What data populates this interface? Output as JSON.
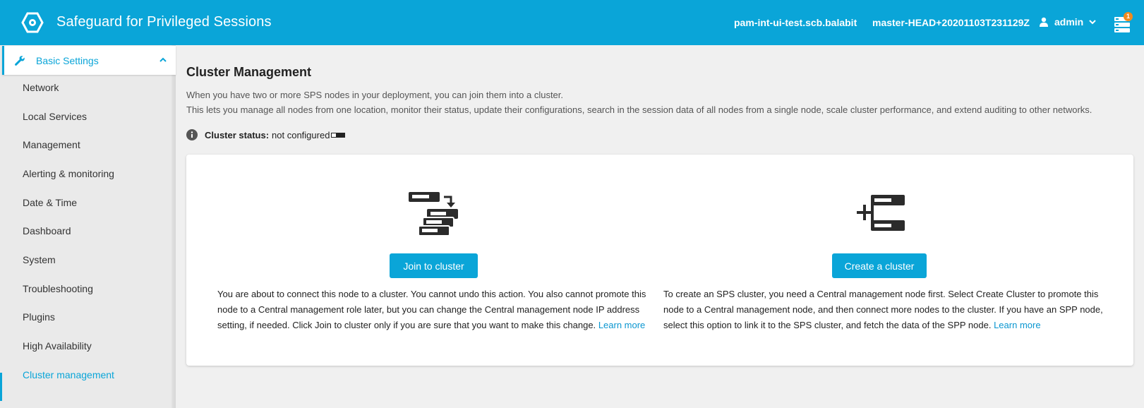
{
  "header": {
    "app_title": "Safeguard for Privileged Sessions",
    "hostname": "pam-int-ui-test.scb.balabit",
    "version": "master-HEAD+20201103T231129Z",
    "user": "admin",
    "notification_count": "1",
    "logo_icon": "safeguard-logo-icon",
    "user_icon": "person-icon",
    "notifications_icon": "server-stack-icon"
  },
  "sidebar": {
    "group": {
      "label": "Basic Settings",
      "icon": "wrench-icon",
      "expanded": true
    },
    "items": [
      {
        "label": "Network"
      },
      {
        "label": "Local Services"
      },
      {
        "label": "Management"
      },
      {
        "label": "Alerting & monitoring"
      },
      {
        "label": "Date & Time"
      },
      {
        "label": "Dashboard"
      },
      {
        "label": "System"
      },
      {
        "label": "Troubleshooting"
      },
      {
        "label": "Plugins"
      },
      {
        "label": "High Availability"
      },
      {
        "label": "Cluster management",
        "active": true
      }
    ]
  },
  "main": {
    "title": "Cluster Management",
    "description_line1": "When you have two or more SPS nodes in your deployment, you can join them into a cluster.",
    "description_line2": "This lets you manage all nodes from one location, monitor their status, update their configurations, search in the session data of all nodes from a single node, scale cluster performance, and extend auditing to other networks.",
    "status_label": "Cluster status:",
    "status_value": "not configured",
    "join": {
      "button": "Join to cluster",
      "text": "You are about to connect this node to a cluster. You cannot undo this action. You also cannot promote this node to a Central management role later, but you can change the Central management node IP address setting, if needed. Click Join to cluster only if you are sure that you want to make this change.",
      "link": "Learn more"
    },
    "create": {
      "button": "Create a cluster",
      "text": "To create an SPS cluster, you need a Central management node first. Select Create Cluster to promote this node to a Central management node, and then connect more nodes to the cluster. If you have an SPP node, select this option to link it to the SPS cluster, and fetch the data of the SPP node.",
      "link": "Learn more"
    }
  },
  "colors": {
    "accent": "#0aa5d8",
    "badge": "#f28a1d",
    "background": "#f0f0f0"
  }
}
